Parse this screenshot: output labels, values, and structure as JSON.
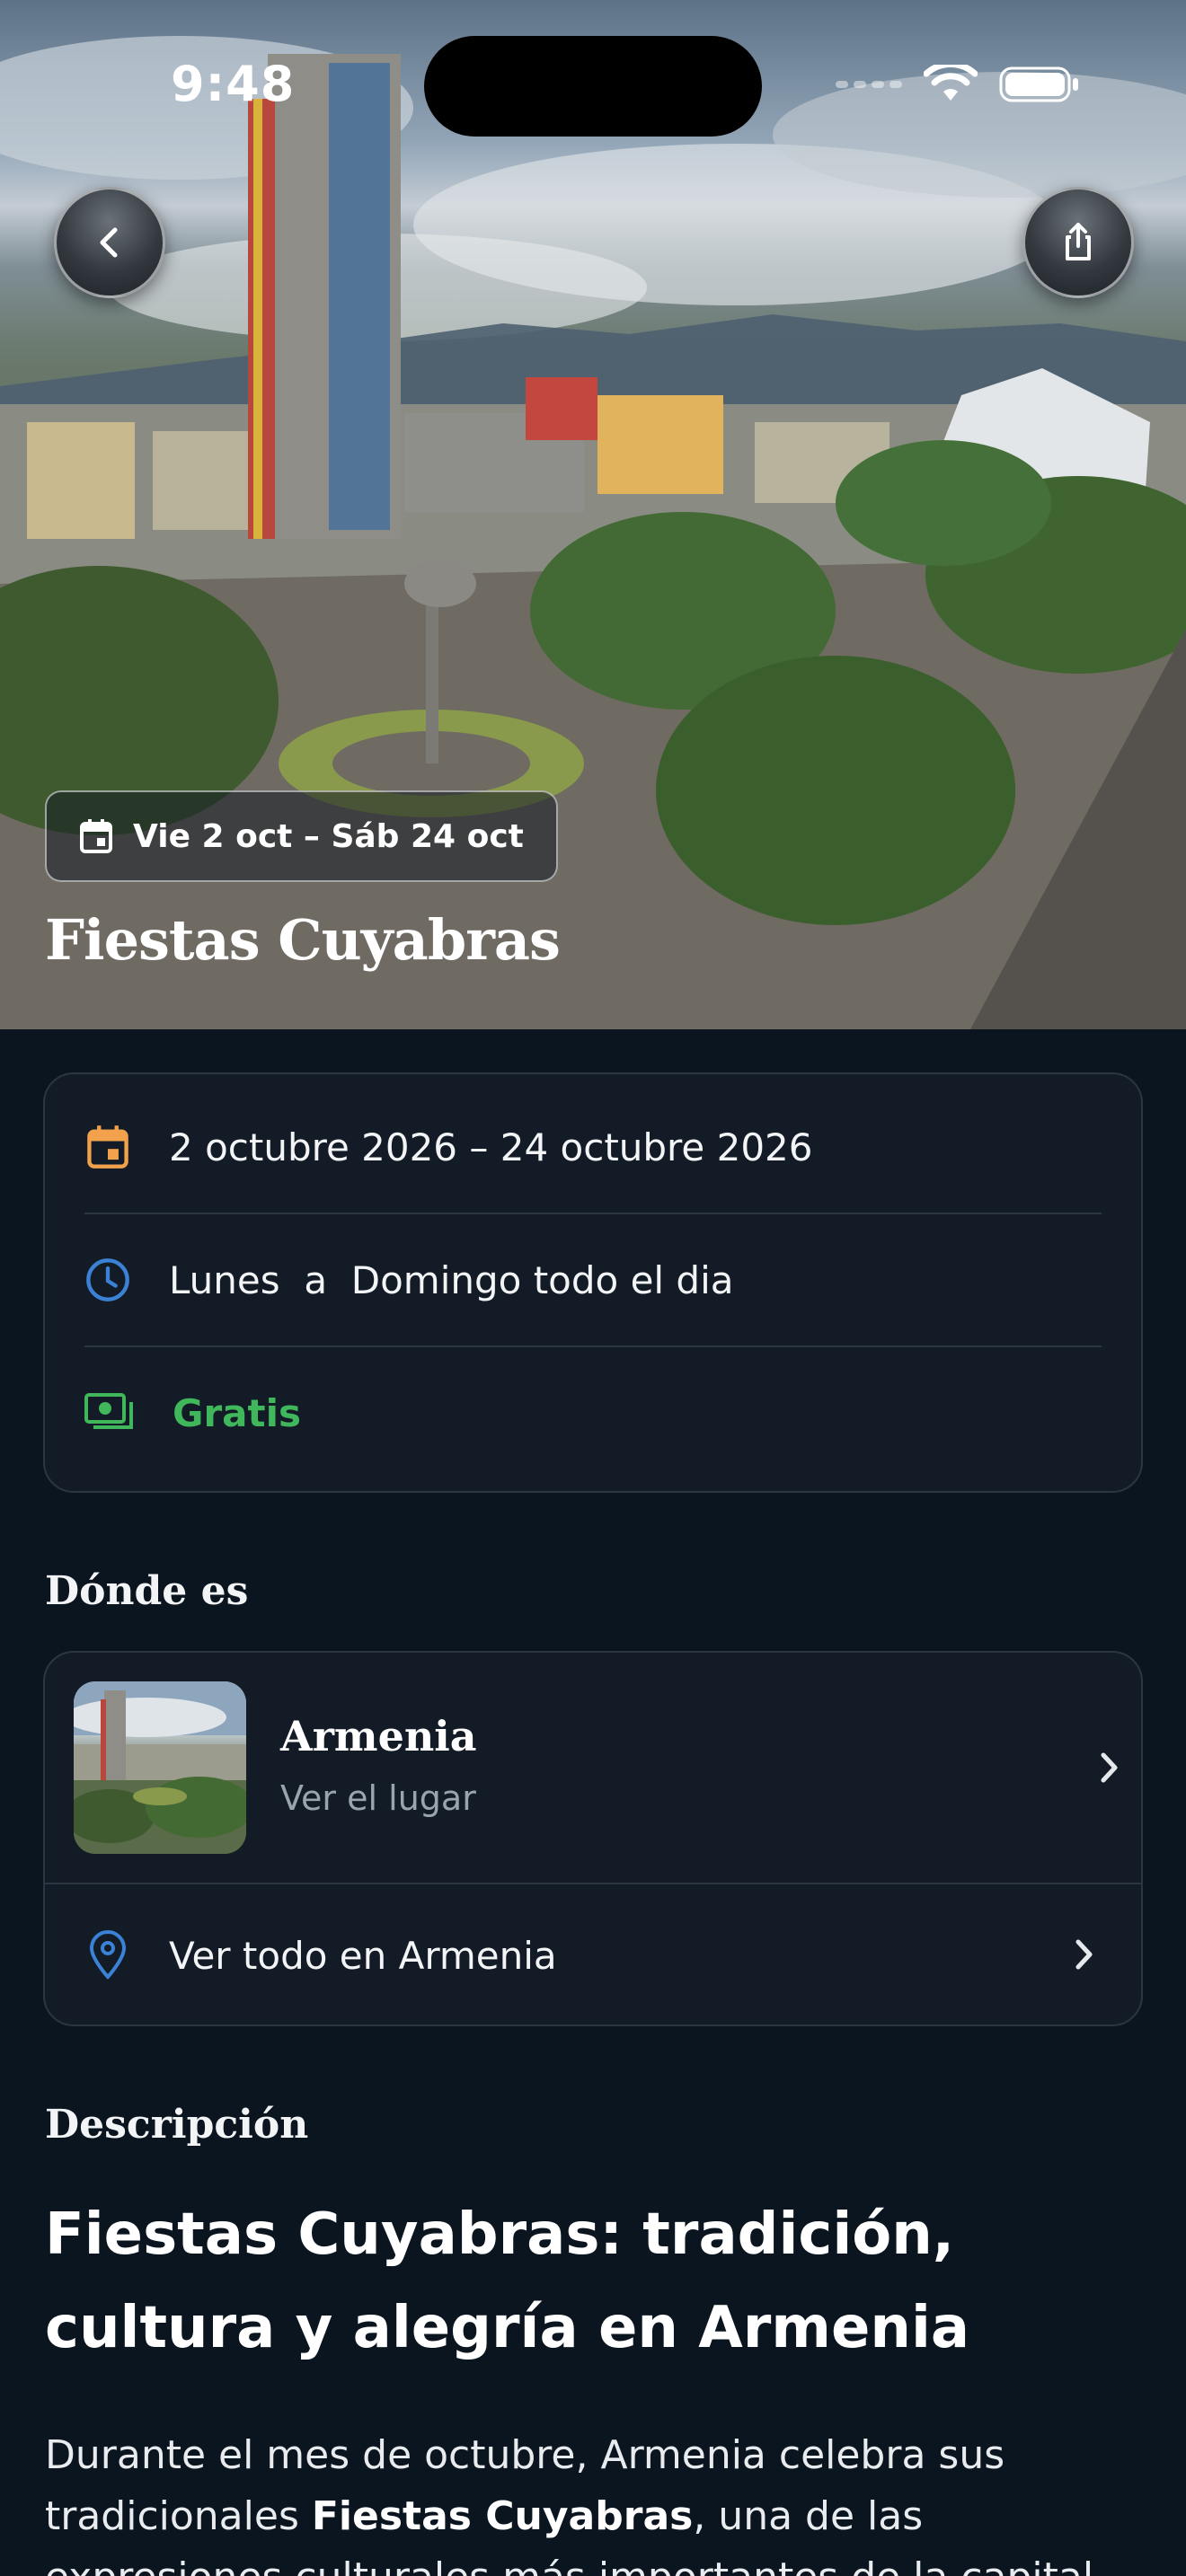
{
  "status_bar": {
    "time": "9:48"
  },
  "hero": {
    "date_chip": "Vie 2 oct – Sáb 24 oct",
    "title": "Fiestas Cuyabras"
  },
  "info": {
    "dates": "2 octubre 2026 – 24 octubre 2026",
    "schedule": "Lunes  a  Domingo todo el dia",
    "price": "Gratis",
    "colors": {
      "calendar_icon": "#f2a14c",
      "clock_icon": "#3b82d6",
      "price": "#3fb75a"
    }
  },
  "location": {
    "section_title": "Dónde es",
    "place_name": "Armenia",
    "place_link": "Ver el lugar",
    "see_all": "Ver todo en Armenia"
  },
  "description": {
    "section_title": "Descripción",
    "heading": "Fiestas Cuyabras: tradición, cultura y alegría en Armenia",
    "body_part1": "Durante el mes de octubre, Armenia celebra sus tradicionales ",
    "body_bold": "Fiestas Cuyabras",
    "body_part2": ", una de las expresiones culturales más importantes de la capital"
  },
  "icons": [
    "back-arrow-icon",
    "share-icon",
    "calendar-icon",
    "clock-icon",
    "money-icon",
    "map-pin-icon",
    "chevron-right-icon"
  ]
}
